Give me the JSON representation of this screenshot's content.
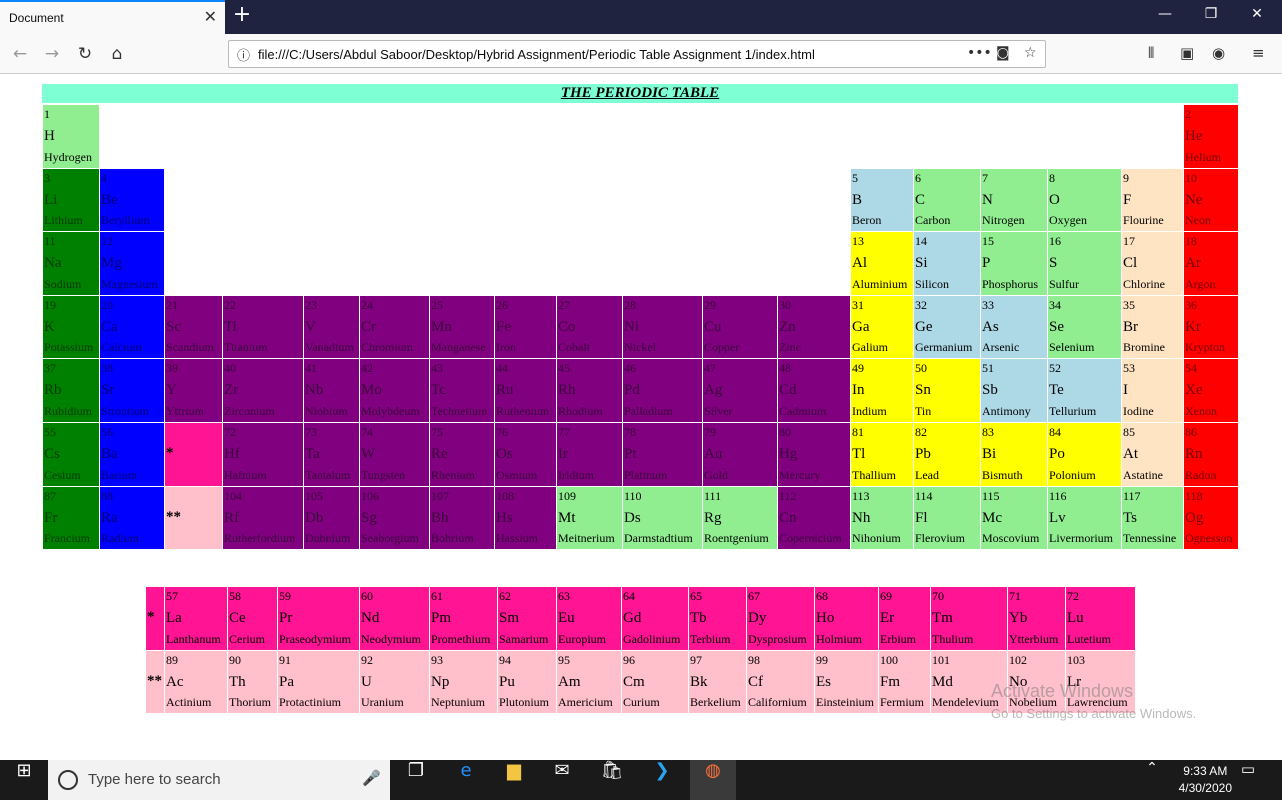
{
  "browser": {
    "tab_title": "Document",
    "url": "file:///C:/Users/Abdul Saboor/Desktop/Hybrid Assignment/Periodic Table Assignment 1/index.html"
  },
  "page": {
    "title": "THE PERIODIC TABLE",
    "watermark_line1": "Activate Windows",
    "watermark_line2": "Go to Settings to activate Windows."
  },
  "colors": {
    "green": "#008000",
    "blue": "#0000ff",
    "purple": "#800080",
    "lightgreen": "#90ee90",
    "lightblue": "#add8e6",
    "yellow": "#ffff00",
    "peach": "#ffe4c4",
    "red": "#ff0000",
    "pink": "#ff1493",
    "lightpink": "#ffc0cb"
  },
  "elements": [
    [
      "1",
      "H",
      "Hydrogen",
      0,
      0,
      "lightgreen"
    ],
    [
      "2",
      "He",
      "Helium",
      17,
      0,
      "red"
    ],
    [
      "3",
      "Li",
      "Lithium",
      0,
      1,
      "green"
    ],
    [
      "4",
      "Be",
      "Beryllium",
      1,
      1,
      "blue"
    ],
    [
      "5",
      "B",
      "Beron",
      12,
      1,
      "lightblue"
    ],
    [
      "6",
      "C",
      "Carbon",
      13,
      1,
      "lightgreen"
    ],
    [
      "7",
      "N",
      "Nitrogen",
      14,
      1,
      "lightgreen"
    ],
    [
      "8",
      "O",
      "Oxygen",
      15,
      1,
      "lightgreen"
    ],
    [
      "9",
      "F",
      "Flourine",
      16,
      1,
      "peach"
    ],
    [
      "10",
      "Ne",
      "Neon",
      17,
      1,
      "red"
    ],
    [
      "11",
      "Na",
      "Sodium",
      0,
      2,
      "green"
    ],
    [
      "12",
      "Mg",
      "Magnesium",
      1,
      2,
      "blue"
    ],
    [
      "13",
      "Al",
      "Aluminium",
      12,
      2,
      "yellow"
    ],
    [
      "14",
      "Si",
      "Silicon",
      13,
      2,
      "lightblue"
    ],
    [
      "15",
      "P",
      "Phosphorus",
      14,
      2,
      "lightgreen"
    ],
    [
      "16",
      "S",
      "Sulfur",
      15,
      2,
      "lightgreen"
    ],
    [
      "17",
      "Cl",
      "Chlorine",
      16,
      2,
      "peach"
    ],
    [
      "18",
      "Ar",
      "Argon",
      17,
      2,
      "red"
    ],
    [
      "19",
      "K",
      "Potassium",
      0,
      3,
      "green"
    ],
    [
      "20",
      "Ca",
      "Calcium",
      1,
      3,
      "blue"
    ],
    [
      "21",
      "Sc",
      "Scandium",
      2,
      3,
      "purple"
    ],
    [
      "22",
      "Ti",
      "Titanium",
      3,
      3,
      "purple"
    ],
    [
      "23",
      "V",
      "Vanadium",
      4,
      3,
      "purple"
    ],
    [
      "24",
      "Cr",
      "Chromium",
      5,
      3,
      "purple"
    ],
    [
      "25",
      "Mn",
      "Manganese",
      6,
      3,
      "purple"
    ],
    [
      "26",
      "Fe",
      "Iron",
      7,
      3,
      "purple"
    ],
    [
      "27",
      "Co",
      "Cobalt",
      8,
      3,
      "purple"
    ],
    [
      "28",
      "Ni",
      "Nickel",
      9,
      3,
      "purple"
    ],
    [
      "29",
      "Cu",
      "Copper",
      10,
      3,
      "purple"
    ],
    [
      "30",
      "Zn",
      "Zinc",
      11,
      3,
      "purple"
    ],
    [
      "31",
      "Ga",
      "Galium",
      12,
      3,
      "yellow"
    ],
    [
      "32",
      "Ge",
      "Germanium",
      13,
      3,
      "lightblue"
    ],
    [
      "33",
      "As",
      "Arsenic",
      14,
      3,
      "lightblue"
    ],
    [
      "34",
      "Se",
      "Selenium",
      15,
      3,
      "lightgreen"
    ],
    [
      "35",
      "Br",
      "Bromine",
      16,
      3,
      "peach"
    ],
    [
      "36",
      "Kr",
      "Krypton",
      17,
      3,
      "red"
    ],
    [
      "37",
      "Rb",
      "Rubidium",
      0,
      4,
      "green"
    ],
    [
      "38",
      "Sr",
      "Strontium",
      1,
      4,
      "blue"
    ],
    [
      "39",
      "Y",
      "Yttrium",
      2,
      4,
      "purple"
    ],
    [
      "40",
      "Zr",
      "Zirconium",
      3,
      4,
      "purple"
    ],
    [
      "41",
      "Nb",
      "Niobium",
      4,
      4,
      "purple"
    ],
    [
      "42",
      "Mo",
      "Molybdeum",
      5,
      4,
      "purple"
    ],
    [
      "43",
      "Tc",
      "Technetium",
      6,
      4,
      "purple"
    ],
    [
      "44",
      "Ru",
      "Ruthenium",
      7,
      4,
      "purple"
    ],
    [
      "45",
      "Rh",
      "Rhodium",
      8,
      4,
      "purple"
    ],
    [
      "46",
      "Pd",
      "Palladium",
      9,
      4,
      "purple"
    ],
    [
      "47",
      "Ag",
      "Silver",
      10,
      4,
      "purple"
    ],
    [
      "48",
      "Cd",
      "Cadmium",
      11,
      4,
      "purple"
    ],
    [
      "49",
      "In",
      "Indium",
      12,
      4,
      "yellow"
    ],
    [
      "50",
      "Sn",
      "Tin",
      13,
      4,
      "yellow"
    ],
    [
      "51",
      "Sb",
      "Antimony",
      14,
      4,
      "lightblue"
    ],
    [
      "52",
      "Te",
      "Tellurium",
      15,
      4,
      "lightblue"
    ],
    [
      "53",
      "I",
      "Iodine",
      16,
      4,
      "peach"
    ],
    [
      "54",
      "Xe",
      "Xenon",
      17,
      4,
      "red"
    ],
    [
      "55",
      "Cs",
      "Cesium",
      0,
      5,
      "green"
    ],
    [
      "56",
      "Ba",
      "Barium",
      1,
      5,
      "blue"
    ],
    [
      "",
      "*",
      "",
      2,
      5,
      "pink"
    ],
    [
      "72",
      "Hf",
      "Hafnium",
      3,
      5,
      "purple"
    ],
    [
      "73",
      "Ta",
      "Tantalum",
      4,
      5,
      "purple"
    ],
    [
      "74",
      "W",
      "Tungsten",
      5,
      5,
      "purple"
    ],
    [
      "75",
      "Re",
      "Rhenium",
      6,
      5,
      "purple"
    ],
    [
      "76",
      "Os",
      "Osmium",
      7,
      5,
      "purple"
    ],
    [
      "77",
      "Ir",
      "Iridium",
      8,
      5,
      "purple"
    ],
    [
      "78",
      "Pt",
      "Platinum",
      9,
      5,
      "purple"
    ],
    [
      "79",
      "Au",
      "Gold",
      10,
      5,
      "purple"
    ],
    [
      "80",
      "Hg",
      "Mercury",
      11,
      5,
      "purple"
    ],
    [
      "81",
      "Tl",
      "Thallium",
      12,
      5,
      "yellow"
    ],
    [
      "82",
      "Pb",
      "Lead",
      13,
      5,
      "yellow"
    ],
    [
      "83",
      "Bi",
      "Bismuth",
      14,
      5,
      "yellow"
    ],
    [
      "84",
      "Po",
      "Polonium",
      15,
      5,
      "yellow"
    ],
    [
      "85",
      "At",
      "Astatine",
      16,
      5,
      "peach"
    ],
    [
      "86",
      "Rn",
      "Radon",
      17,
      5,
      "red"
    ],
    [
      "87",
      "Fr",
      "Francium",
      0,
      6,
      "green"
    ],
    [
      "88",
      "Ra",
      "Radium",
      1,
      6,
      "blue"
    ],
    [
      "",
      "**",
      "",
      2,
      6,
      "lightpink"
    ],
    [
      "104",
      "Rf",
      "Rutherfordium",
      3,
      6,
      "purple"
    ],
    [
      "105",
      "Db",
      "Dubnium",
      4,
      6,
      "purple"
    ],
    [
      "106",
      "Sg",
      "Seaborgium",
      5,
      6,
      "purple"
    ],
    [
      "107",
      "Bh",
      "Bohrium",
      6,
      6,
      "purple"
    ],
    [
      "108",
      "Hs",
      "Hassium",
      7,
      6,
      "purple"
    ],
    [
      "109",
      "Mt",
      "Meitnerium",
      8,
      6,
      "lightgreen"
    ],
    [
      "110",
      "Ds",
      "Darmstadtium",
      9,
      6,
      "lightgreen"
    ],
    [
      "111",
      "Rg",
      "Roentgenium",
      10,
      6,
      "lightgreen"
    ],
    [
      "112",
      "Cn",
      "Copernicium",
      11,
      6,
      "purple"
    ],
    [
      "113",
      "Nh",
      "Nihonium",
      12,
      6,
      "lightgreen"
    ],
    [
      "114",
      "Fl",
      "Flerovium",
      13,
      6,
      "lightgreen"
    ],
    [
      "115",
      "Mc",
      "Moscovium",
      14,
      6,
      "lightgreen"
    ],
    [
      "116",
      "Lv",
      "Livermorium",
      15,
      6,
      "lightgreen"
    ],
    [
      "117",
      "Ts",
      "Tennessine",
      16,
      6,
      "lightgreen"
    ],
    [
      "118",
      "Og",
      "Ognesson",
      17,
      6,
      "red"
    ]
  ],
  "fblock": [
    [
      "",
      "*",
      "",
      0,
      0,
      "pink"
    ],
    [
      "57",
      "La",
      "Lanthanum",
      1,
      0,
      "pink"
    ],
    [
      "58",
      "Ce",
      "Cerium",
      2,
      0,
      "pink"
    ],
    [
      "59",
      "Pr",
      "Praseodymium",
      3,
      0,
      "pink"
    ],
    [
      "60",
      "Nd",
      "Neodymium",
      4,
      0,
      "pink"
    ],
    [
      "61",
      "Pm",
      "Promethium",
      5,
      0,
      "pink"
    ],
    [
      "62",
      "Sm",
      "Samarium",
      6,
      0,
      "pink"
    ],
    [
      "63",
      "Eu",
      "Europium",
      7,
      0,
      "pink"
    ],
    [
      "64",
      "Gd",
      "Gadolinium",
      8,
      0,
      "pink"
    ],
    [
      "65",
      "Tb",
      "Terbium",
      9,
      0,
      "pink"
    ],
    [
      "67",
      "Dy",
      "Dysprosium",
      10,
      0,
      "pink"
    ],
    [
      "68",
      "Ho",
      "Holmium",
      11,
      0,
      "pink"
    ],
    [
      "69",
      "Er",
      "Erbium",
      12,
      0,
      "pink"
    ],
    [
      "70",
      "Tm",
      "Thulium",
      13,
      0,
      "pink"
    ],
    [
      "71",
      "Yb",
      "Ytterbium",
      14,
      0,
      "pink"
    ],
    [
      "72",
      "Lu",
      "Lutetium",
      15,
      0,
      "pink"
    ],
    [
      "",
      "**",
      "",
      0,
      1,
      "lightpink"
    ],
    [
      "89",
      "Ac",
      "Actinium",
      1,
      1,
      "lightpink"
    ],
    [
      "90",
      "Th",
      "Thorium",
      2,
      1,
      "lightpink"
    ],
    [
      "91",
      "Pa",
      "Protactinium",
      3,
      1,
      "lightpink"
    ],
    [
      "92",
      "U",
      "Uranium",
      4,
      1,
      "lightpink"
    ],
    [
      "93",
      "Np",
      "Neptunium",
      5,
      1,
      "lightpink"
    ],
    [
      "94",
      "Pu",
      "Plutonium",
      6,
      1,
      "lightpink"
    ],
    [
      "95",
      "Am",
      "Americium",
      7,
      1,
      "lightpink"
    ],
    [
      "96",
      "Cm",
      "Curium",
      8,
      1,
      "lightpink"
    ],
    [
      "97",
      "Bk",
      "Berkelium",
      9,
      1,
      "lightpink"
    ],
    [
      "98",
      "Cf",
      "Californium",
      10,
      1,
      "lightpink"
    ],
    [
      "99",
      "Es",
      "Einsteinium",
      11,
      1,
      "lightpink"
    ],
    [
      "100",
      "Fm",
      "Fermium",
      12,
      1,
      "lightpink"
    ],
    [
      "101",
      "Md",
      "Mendelevium",
      13,
      1,
      "lightpink"
    ],
    [
      "102",
      "No",
      "Nobelium",
      14,
      1,
      "lightpink"
    ],
    [
      "103",
      "Lr",
      "Lawrencium",
      15,
      1,
      "lightpink"
    ]
  ],
  "taskbar": {
    "search_placeholder": "Type here to search",
    "time": "9:33 AM",
    "date": "4/30/2020"
  }
}
